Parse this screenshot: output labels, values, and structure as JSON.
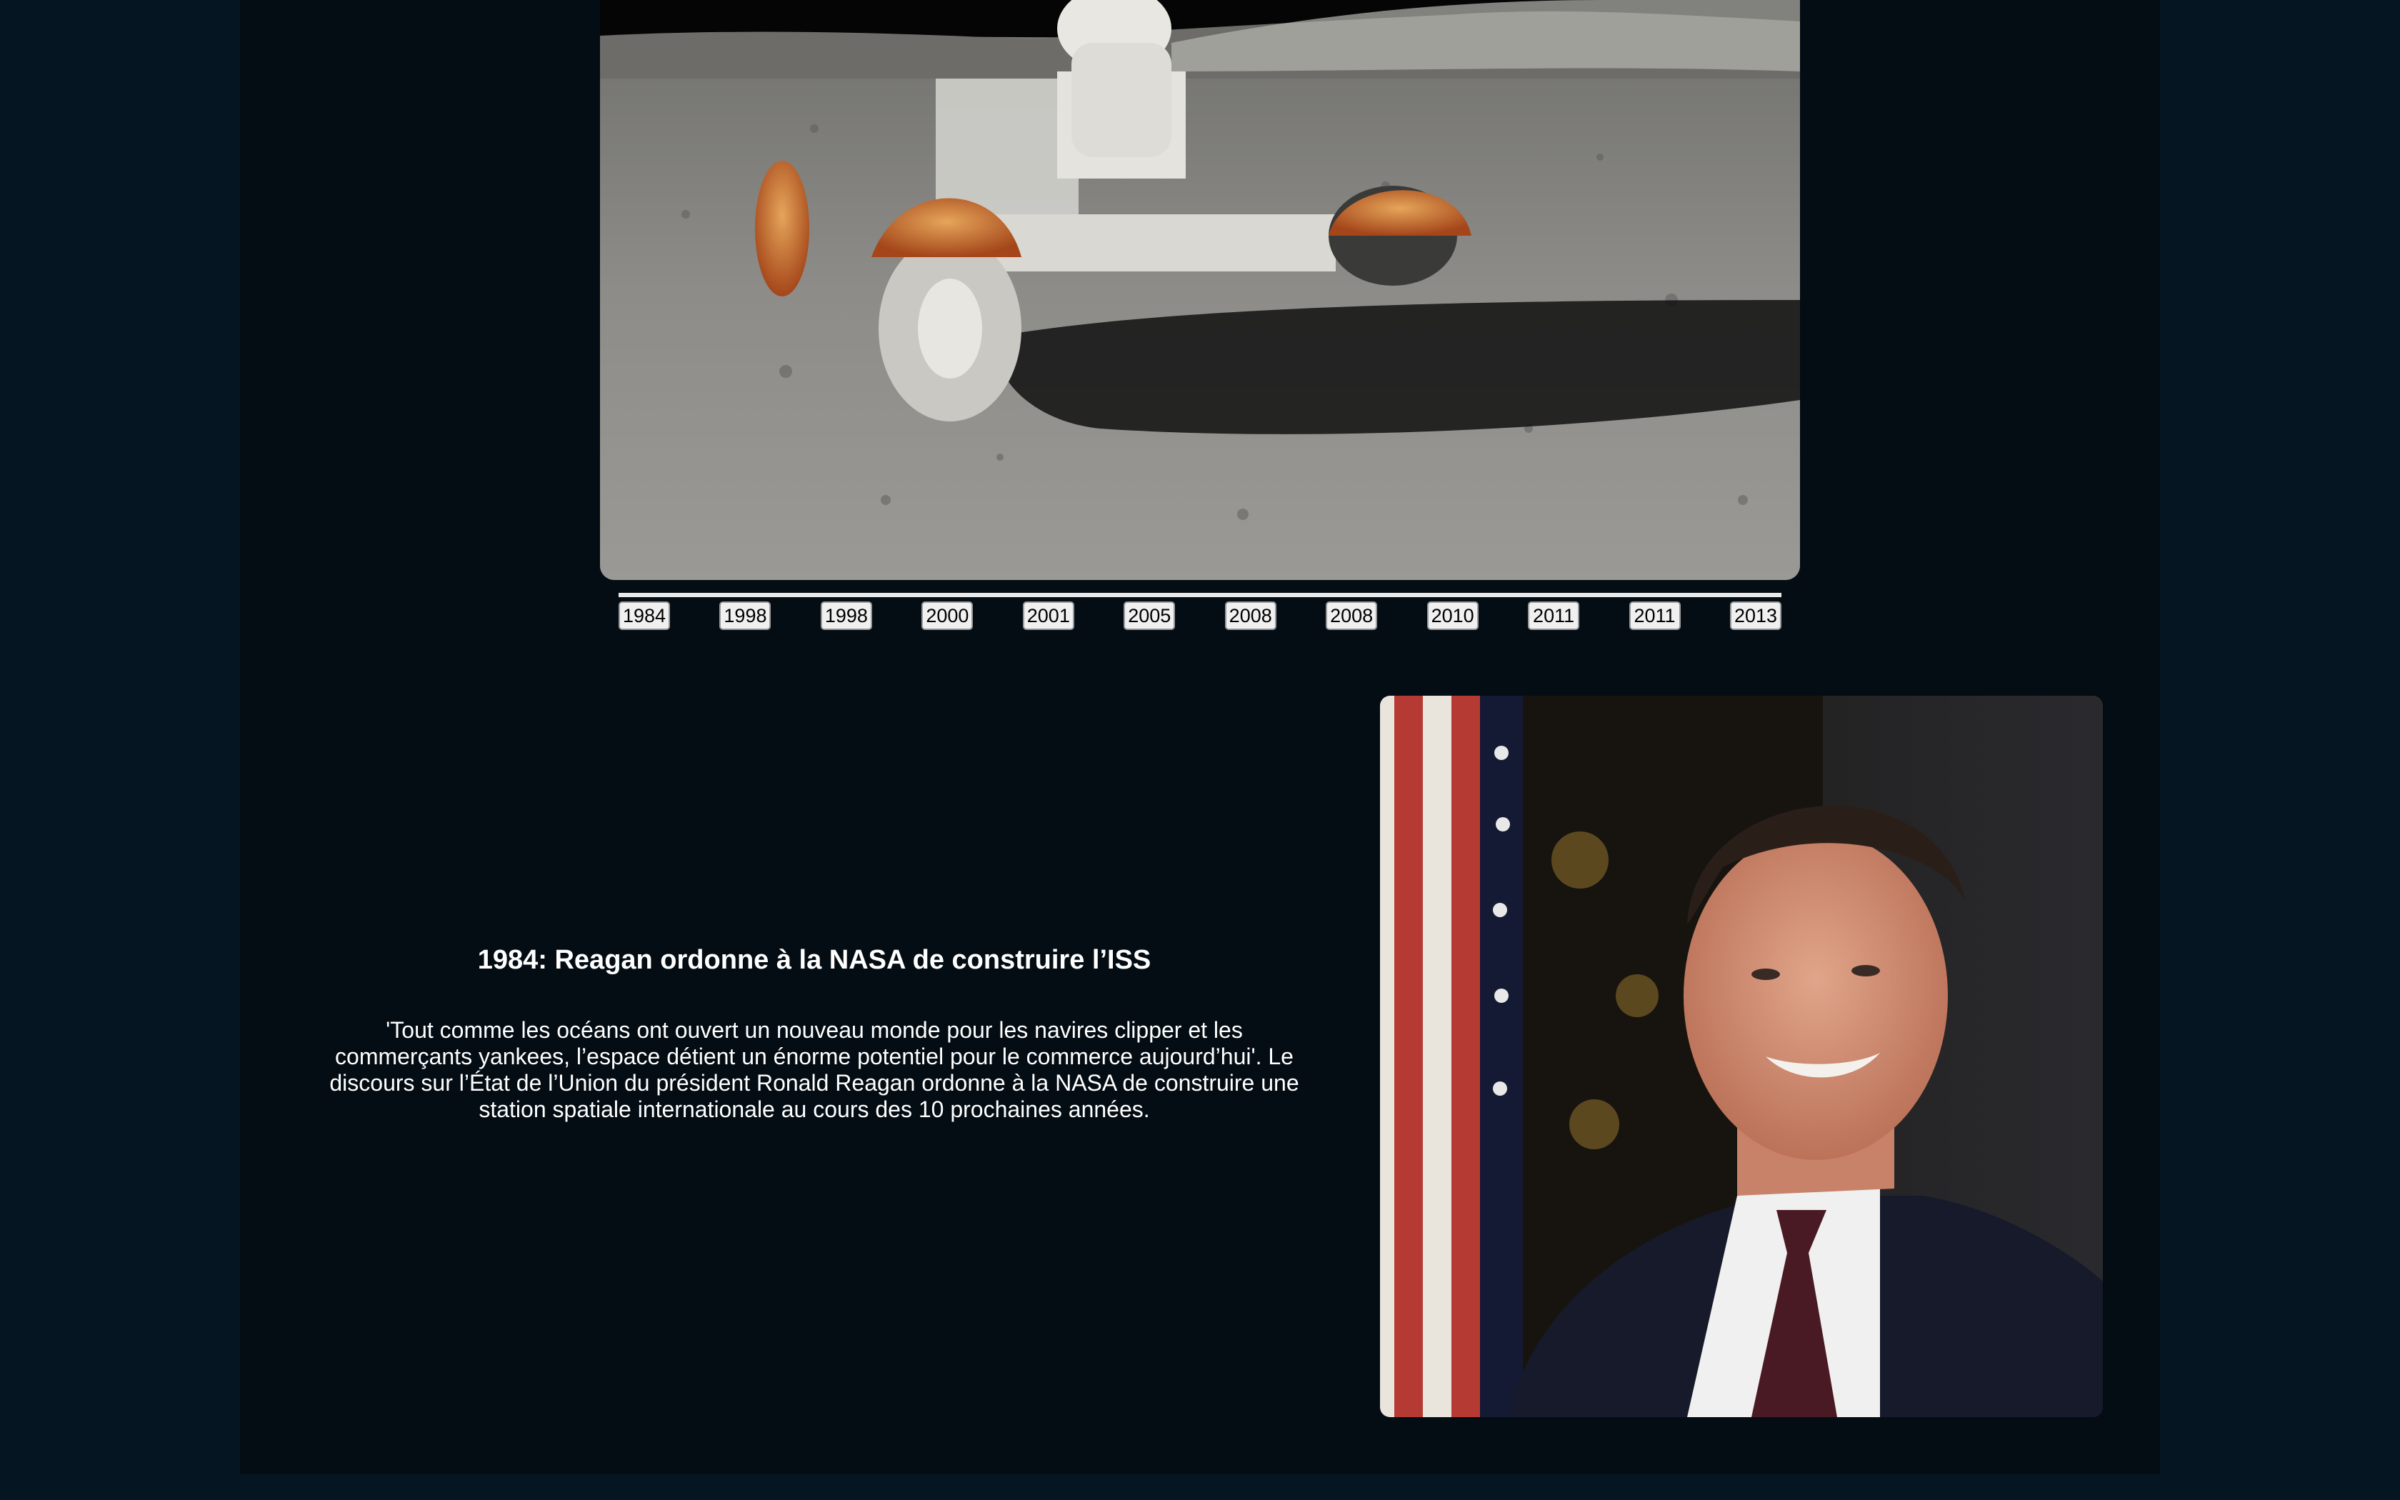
{
  "hero_image": {
    "subject": "Apollo lunar rover on the moon surface"
  },
  "timeline": {
    "years": [
      "1984",
      "1998",
      "1998",
      "2000",
      "2001",
      "2005",
      "2008",
      "2008",
      "2010",
      "2011",
      "2011",
      "2013"
    ],
    "selected_index": 0
  },
  "event": {
    "title": "1984: Reagan ordonne à la NASA de construire l’ISS",
    "description": "'Tout comme les océans ont ouvert un nouveau monde pour les navires clipper et les commerçants yankees, l’espace détient un énorme potentiel pour le commerce aujourd’hui'. Le discours sur l’État de l’Union du président Ronald Reagan ordonne à la NASA de construire une station spatiale internationale au cours des 10 prochaines années."
  },
  "portrait": {
    "subject": "Portrait photo of Ronald Reagan"
  },
  "colors": {
    "page_background": "#051521",
    "panel_background": "#040d14",
    "text": "#ffffff",
    "timeline_line": "#e9e9ea"
  }
}
